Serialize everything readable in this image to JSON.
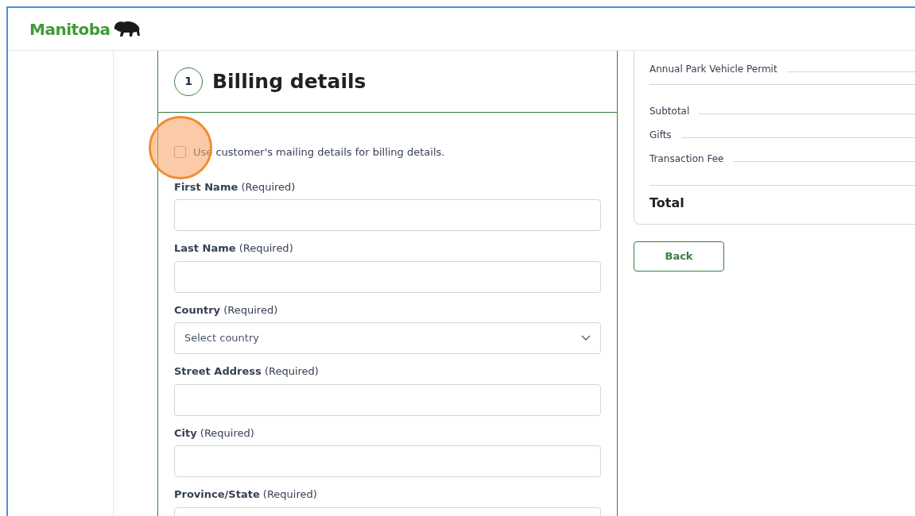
{
  "header": {
    "logo_text": "Manitoba"
  },
  "billing": {
    "step": "1",
    "title": "Billing details",
    "use_mailing": {
      "label": "Use customer's mailing details for billing details.",
      "checked": false
    },
    "fields": [
      {
        "kind": "text",
        "label": "**First Name** (Required)"
      },
      {
        "kind": "text",
        "label": "**Last Name** (Required)"
      },
      {
        "kind": "select",
        "label": "**Country** (Required)",
        "placeholder": "Select country"
      },
      {
        "kind": "text",
        "label": "**Street Address** (Required)"
      },
      {
        "kind": "text",
        "label": "**City** (Required)"
      },
      {
        "kind": "text",
        "label": "**Province/State** (Required)"
      }
    ]
  },
  "summary": {
    "items": [
      {
        "label": "Annual Park Vehicle Permit"
      }
    ],
    "totals": [
      {
        "label": "Subtotal"
      },
      {
        "label": "Gifts"
      },
      {
        "label": "Transaction Fee"
      }
    ],
    "total_label": "Total"
  },
  "buttons": [
    {
      "label": "Back"
    }
  ]
}
